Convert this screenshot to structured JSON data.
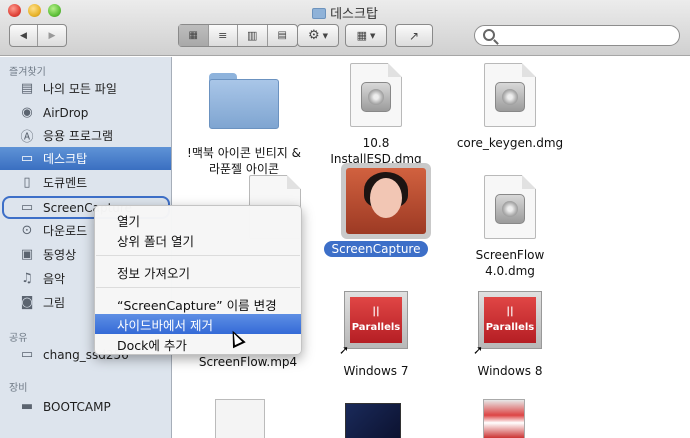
{
  "window": {
    "title": "데스크탑"
  },
  "toolbar": {
    "back_icon": "back-arrow-icon",
    "forward_icon": "forward-arrow-icon",
    "view_icons": [
      "icon-view-icon",
      "list-view-icon",
      "column-view-icon",
      "coverflow-view-icon"
    ],
    "action_icon": "gear-icon",
    "arrange_icon": "arrange-icon",
    "share_icon": "share-icon",
    "search_placeholder": ""
  },
  "sidebar": {
    "favorites_header": "즐겨찾기",
    "favorites": [
      {
        "label": "나의 모든 파일",
        "icon": "all-files-icon"
      },
      {
        "label": "AirDrop",
        "icon": "airdrop-icon"
      },
      {
        "label": "응용 프로그램",
        "icon": "applications-icon"
      },
      {
        "label": "데스크탑",
        "icon": "desktop-icon"
      },
      {
        "label": "도큐멘트",
        "icon": "documents-icon"
      },
      {
        "label": "ScreenCapture",
        "icon": "folder-icon"
      },
      {
        "label": "다운로드",
        "icon": "downloads-icon"
      },
      {
        "label": "동영상",
        "icon": "movies-icon"
      },
      {
        "label": "음악",
        "icon": "music-icon"
      },
      {
        "label": "그림",
        "icon": "pictures-icon"
      }
    ],
    "shared_header": "공유",
    "shared": [
      {
        "label": "chang_ssd256",
        "icon": "shared-computer-icon"
      }
    ],
    "devices_header": "장비",
    "devices": [
      {
        "label": "BOOTCAMP",
        "icon": "disk-icon"
      }
    ]
  },
  "files": [
    {
      "name_line1": "!맥북 아이콘 빈티지 &",
      "name_line2": "라푼젤 아이콘",
      "kind": "folder"
    },
    {
      "name_line1": "10.8",
      "name_line2": "InstallESD.dmg",
      "kind": "dmg"
    },
    {
      "name_line1": "core_keygen.dmg",
      "name_line2": "",
      "kind": "dmg"
    },
    {
      "name_line1": "ScreenCapture",
      "name_line2": "",
      "kind": "folder-image"
    },
    {
      "name_line1": "ScreenFlow",
      "name_line2": "4.0.dmg",
      "kind": "dmg"
    },
    {
      "name_line1": "ScreenFlow.mp4",
      "name_line2": "",
      "kind": "video"
    },
    {
      "name_line1": "Windows 7",
      "name_line2": "",
      "kind": "parallels",
      "badge": "|| Parallels"
    },
    {
      "name_line1": "Windows 8",
      "name_line2": "",
      "kind": "parallels",
      "badge": "|| Parallels"
    }
  ],
  "context_menu": {
    "items": [
      {
        "label": "열기"
      },
      {
        "label": "상위 폴더 열기"
      },
      {
        "label": "정보 가져오기"
      },
      {
        "label": "“ScreenCapture” 이름 변경"
      },
      {
        "label": "사이드바에서 제거",
        "highlighted": true
      },
      {
        "label": "Dock에 추가"
      }
    ]
  },
  "colors": {
    "selection": "#3d6fc8",
    "sidebar_bg": "#dde4ed",
    "menu_highlight": "#346ad7"
  }
}
